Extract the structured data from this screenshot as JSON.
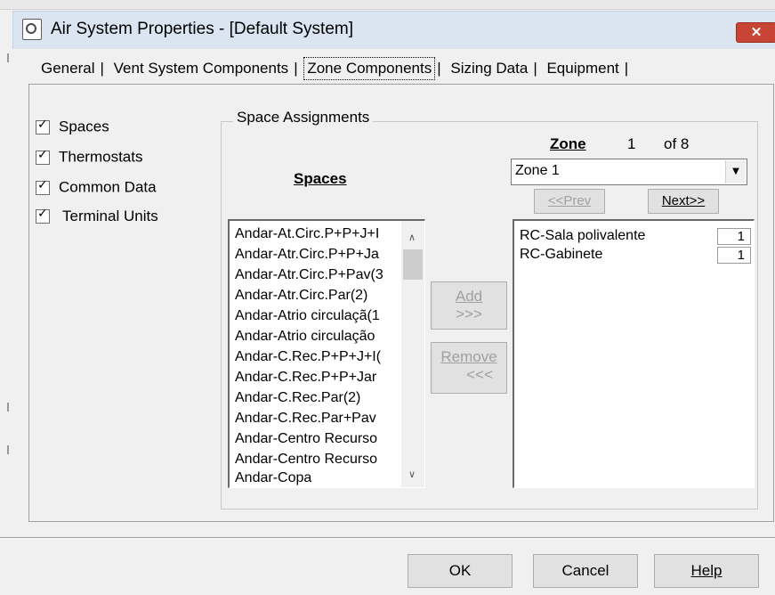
{
  "window": {
    "title": "Air System Properties - [Default System]",
    "close_label": "✕"
  },
  "tabs": [
    {
      "label": "General",
      "active": false
    },
    {
      "label": "Vent System Components",
      "active": false
    },
    {
      "label": "Zone Components",
      "active": true
    },
    {
      "label": "Sizing Data",
      "active": false
    },
    {
      "label": "Equipment",
      "active": false
    }
  ],
  "tab_separator": "|",
  "checkboxes": [
    {
      "label": "Spaces",
      "checked": true
    },
    {
      "label": "Thermostats",
      "checked": true
    },
    {
      "label": "Common Data",
      "checked": true
    },
    {
      "label": "Terminal Units",
      "checked": true
    }
  ],
  "space_assignments": {
    "group_title": "Space Assignments",
    "spaces_header": "Spaces",
    "zone_label": "Zone",
    "zone_number": "1",
    "zone_of": "of 8",
    "zone_select": "Zone 1",
    "spaces": [
      "Andar-At.Circ.P+P+J+I",
      "Andar-Atr.Circ.P+P+Ja",
      "Andar-Atr.Circ.P+Pav(3",
      "Andar-Atr.Circ.Par(2)",
      "Andar-Atrio circulaçã(1",
      "Andar-Atrio circulação",
      "Andar-C.Rec.P+P+J+I(",
      "Andar-C.Rec.P+P+Jar",
      "Andar-C.Rec.Par(2)",
      "Andar-C.Rec.Par+Pav",
      "Andar-Centro Recurso",
      "Andar-Centro Recurso",
      "Andar-Copa"
    ],
    "zone_spaces": [
      {
        "name": "RC-Sala polivalente",
        "qty": "1"
      },
      {
        "name": "RC-Gabinete",
        "qty": "1"
      }
    ],
    "add_button": {
      "line1": "Add",
      "line2": ">>>"
    },
    "remove_button": {
      "line1": "Remove",
      "line2": "<<<"
    },
    "prev_button": "<<Prev",
    "next_button": "Next>>"
  },
  "footer": {
    "ok_label": "OK",
    "cancel_label": "Cancel",
    "help_label": "Help"
  },
  "colors": {
    "titlebar": "#dbe5f1",
    "close": "#c84536",
    "panel": "#f0f0f0",
    "disabled_text": "#a0a0a0"
  }
}
